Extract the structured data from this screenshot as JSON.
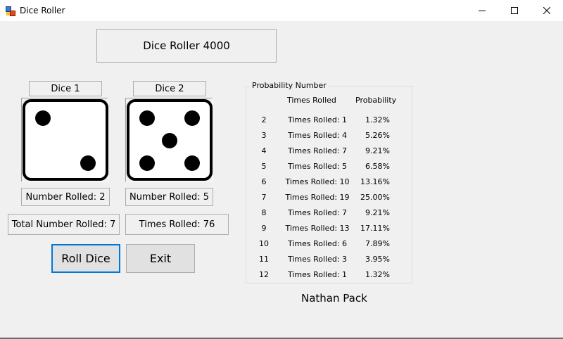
{
  "window": {
    "title": "Dice Roller",
    "minimize_icon": "minimize-icon",
    "maximize_icon": "maximize-icon",
    "close_icon": "close-icon"
  },
  "header": {
    "title": "Dice Roller 4000"
  },
  "dice": [
    {
      "label": "Dice 1",
      "number_rolled": "Number Rolled: 2",
      "value": 2
    },
    {
      "label": "Dice 2",
      "number_rolled": "Number Rolled: 5",
      "value": 5
    }
  ],
  "totals": {
    "total_number_rolled": "Total Number Rolled: 7",
    "times_rolled": "Times Rolled: 76"
  },
  "buttons": {
    "roll": "Roll Dice",
    "exit": "Exit"
  },
  "probability": {
    "group_title": "Probability Number",
    "header_times": "Times Rolled",
    "header_prob": "Probability",
    "rows": [
      {
        "number": "2",
        "times": "Times Rolled: 1",
        "prob": "1.32%"
      },
      {
        "number": "3",
        "times": "Times Rolled: 4",
        "prob": "5.26%"
      },
      {
        "number": "4",
        "times": "Times Rolled: 7",
        "prob": "9.21%"
      },
      {
        "number": "5",
        "times": "Times Rolled: 5",
        "prob": "6.58%"
      },
      {
        "number": "6",
        "times": "Times Rolled: 10",
        "prob": "13.16%"
      },
      {
        "number": "7",
        "times": "Times Rolled: 19",
        "prob": "25.00%"
      },
      {
        "number": "8",
        "times": "Times Rolled: 7",
        "prob": "9.21%"
      },
      {
        "number": "9",
        "times": "Times Rolled: 13",
        "prob": "17.11%"
      },
      {
        "number": "10",
        "times": "Times Rolled: 6",
        "prob": "7.89%"
      },
      {
        "number": "11",
        "times": "Times Rolled: 3",
        "prob": "3.95%"
      },
      {
        "number": "12",
        "times": "Times Rolled: 1",
        "prob": "1.32%"
      }
    ]
  },
  "author": "Nathan Pack",
  "colors": {
    "focus_border": "#0078d7",
    "pip": "#000000",
    "window_bg": "#f0f0f0"
  }
}
